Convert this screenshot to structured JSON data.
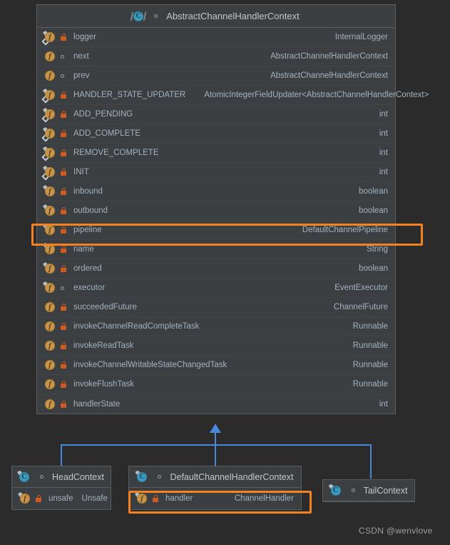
{
  "diagram": {
    "background_color": "#2b2b2b",
    "panel_color": "#3c3f41",
    "highlight_color": "#f58220",
    "connector_color": "#4a88d8"
  },
  "main_class": {
    "title": "AbstractChannelHandlerContext",
    "icon": "abstract-class-icon",
    "visibility_icon": "package-private-icon",
    "fields": [
      {
        "name": "logger",
        "type": "InternalLogger",
        "icon": "static-final-field-icon",
        "visibility": "private"
      },
      {
        "name": "next",
        "type": "AbstractChannelHandlerContext",
        "icon": "field-icon",
        "visibility": "package"
      },
      {
        "name": "prev",
        "type": "AbstractChannelHandlerContext",
        "icon": "field-icon",
        "visibility": "package"
      },
      {
        "name": "HANDLER_STATE_UPDATER",
        "type": "AtomicIntegerFieldUpdater<AbstractChannelHandlerContext>",
        "icon": "static-final-field-icon",
        "visibility": "private",
        "inline_type": true
      },
      {
        "name": "ADD_PENDING",
        "type": "int",
        "icon": "static-final-field-icon",
        "visibility": "private"
      },
      {
        "name": "ADD_COMPLETE",
        "type": "int",
        "icon": "static-final-field-icon",
        "visibility": "private"
      },
      {
        "name": "REMOVE_COMPLETE",
        "type": "int",
        "icon": "static-final-field-icon",
        "visibility": "private"
      },
      {
        "name": "INIT",
        "type": "int",
        "icon": "static-final-field-icon",
        "visibility": "private"
      },
      {
        "name": "inbound",
        "type": "boolean",
        "icon": "final-field-icon",
        "visibility": "private"
      },
      {
        "name": "outbound",
        "type": "boolean",
        "icon": "final-field-icon",
        "visibility": "private"
      },
      {
        "name": "pipeline",
        "type": "DefaultChannelPipeline",
        "icon": "final-field-icon",
        "visibility": "private",
        "highlighted": true
      },
      {
        "name": "name",
        "type": "String",
        "icon": "final-field-icon",
        "visibility": "private"
      },
      {
        "name": "ordered",
        "type": "boolean",
        "icon": "final-field-icon",
        "visibility": "private"
      },
      {
        "name": "executor",
        "type": "EventExecutor",
        "icon": "final-field-icon",
        "visibility": "package"
      },
      {
        "name": "succeededFuture",
        "type": "ChannelFuture",
        "icon": "field-icon",
        "visibility": "private"
      },
      {
        "name": "invokeChannelReadCompleteTask",
        "type": "Runnable",
        "icon": "field-icon",
        "visibility": "private"
      },
      {
        "name": "invokeReadTask",
        "type": "Runnable",
        "icon": "field-icon",
        "visibility": "private"
      },
      {
        "name": "invokeChannelWritableStateChangedTask",
        "type": "Runnable",
        "icon": "field-icon",
        "visibility": "private"
      },
      {
        "name": "invokeFlushTask",
        "type": "Runnable",
        "icon": "field-icon",
        "visibility": "private"
      },
      {
        "name": "handlerState",
        "type": "int",
        "icon": "field-icon",
        "visibility": "private"
      }
    ]
  },
  "subclasses": [
    {
      "id": "head-context",
      "title": "HeadContext",
      "icon": "final-class-icon",
      "visibility_icon": "package-private-icon",
      "fields": [
        {
          "name": "unsafe",
          "type": "Unsafe",
          "icon": "final-field-icon",
          "visibility": "private",
          "highlighted": false
        }
      ]
    },
    {
      "id": "default-channel-handler-context",
      "title": "DefaultChannelHandlerContext",
      "icon": "final-class-icon",
      "visibility_icon": "package-private-icon",
      "fields": [
        {
          "name": "handler",
          "type": "ChannelHandler",
          "icon": "final-field-icon",
          "visibility": "private",
          "highlighted": true
        }
      ]
    },
    {
      "id": "tail-context",
      "title": "TailContext",
      "icon": "final-class-icon",
      "visibility_icon": "package-private-icon",
      "fields": []
    }
  ],
  "watermark": "CSDN @wenvlove"
}
